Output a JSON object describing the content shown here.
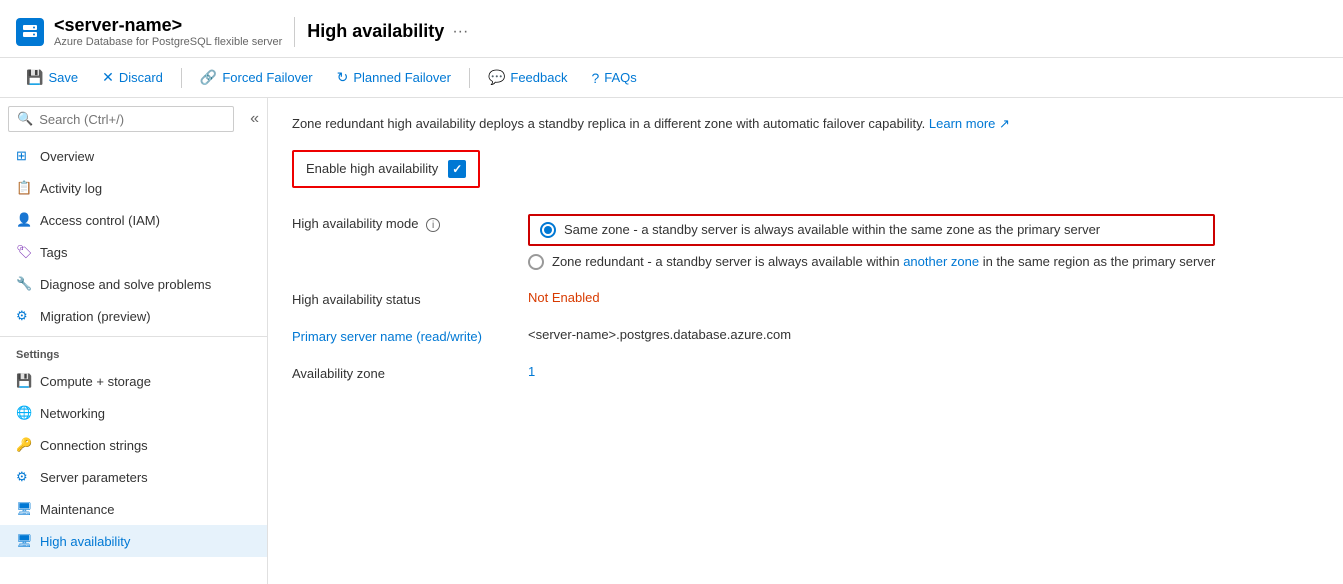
{
  "header": {
    "server_name": "<server-name>",
    "subtitle": "Azure Database for PostgreSQL flexible server",
    "divider": "|",
    "page_title": "High availability",
    "ellipsis": "···"
  },
  "toolbar": {
    "save_label": "Save",
    "discard_label": "Discard",
    "forced_failover_label": "Forced Failover",
    "planned_failover_label": "Planned Failover",
    "feedback_label": "Feedback",
    "faqs_label": "FAQs"
  },
  "search": {
    "placeholder": "Search (Ctrl+/)"
  },
  "sidebar": {
    "items": [
      {
        "label": "Overview",
        "icon": "overview"
      },
      {
        "label": "Activity log",
        "icon": "activity-log"
      },
      {
        "label": "Access control (IAM)",
        "icon": "access-control"
      },
      {
        "label": "Tags",
        "icon": "tags"
      },
      {
        "label": "Diagnose and solve problems",
        "icon": "diagnose"
      },
      {
        "label": "Migration (preview)",
        "icon": "migration"
      }
    ],
    "settings_label": "Settings",
    "settings_items": [
      {
        "label": "Compute + storage",
        "icon": "compute"
      },
      {
        "label": "Networking",
        "icon": "networking"
      },
      {
        "label": "Connection strings",
        "icon": "connection"
      },
      {
        "label": "Server parameters",
        "icon": "parameters"
      },
      {
        "label": "Maintenance",
        "icon": "maintenance"
      },
      {
        "label": "High availability",
        "icon": "high-availability",
        "active": true
      }
    ]
  },
  "content": {
    "intro_text": "Zone redundant high availability deploys a standby replica in a different zone with automatic failover capability.",
    "learn_more": "Learn more",
    "enable_ha_label": "Enable high availability",
    "ha_mode_label": "High availability mode",
    "ha_mode_info": "ℹ",
    "radio_options": [
      {
        "label": "Same zone - a standby server is always available within the same zone as the primary server",
        "selected": true
      },
      {
        "label_part1": "Zone redundant - a standby server is always available within another zone in the same region as the primary server",
        "selected": false
      }
    ],
    "status_label": "High availability status",
    "status_value": "Not Enabled",
    "primary_server_label": "Primary server name (read/write)",
    "primary_server_value": "<server-name>.postgres.database.azure.com",
    "availability_zone_label": "Availability zone",
    "availability_zone_value": "1"
  }
}
